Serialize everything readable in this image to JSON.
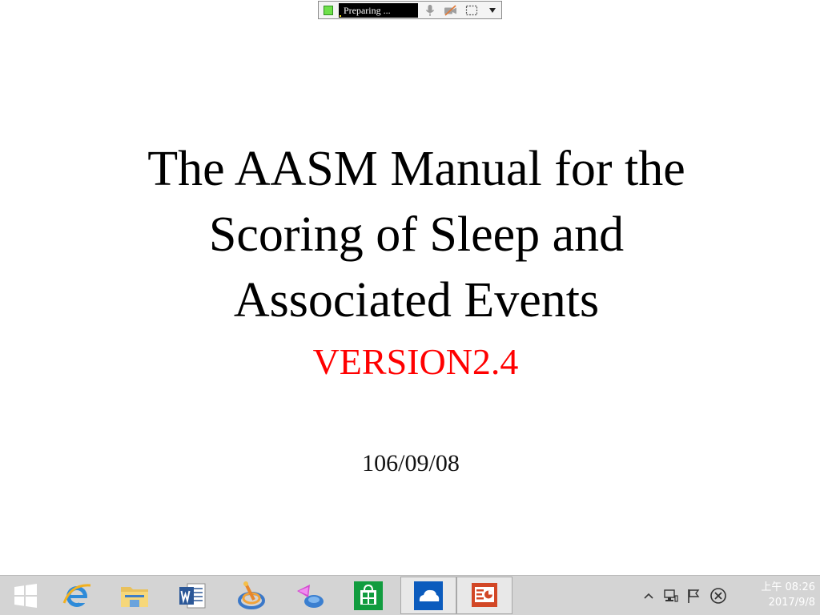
{
  "recorder": {
    "status_text": "Preparing ...",
    "status_progress": 0.02,
    "accent_color": "#6ee04a",
    "icons": [
      "microphone-icon",
      "camera-off-icon",
      "region-select-icon",
      "dropdown-arrow-icon"
    ]
  },
  "slide": {
    "title_lines": [
      "The AASM Manual for the",
      "Scoring of Sleep and",
      "Associated Events"
    ],
    "version": "VERSION2.4",
    "date": "106/09/08",
    "version_color": "#ff0000"
  },
  "taskbar": {
    "apps": [
      {
        "name": "start-button",
        "icon": "windows-logo-icon",
        "active": false
      },
      {
        "name": "internet-explorer",
        "icon": "internet-explorer-icon",
        "active": false
      },
      {
        "name": "file-explorer",
        "icon": "folder-icon",
        "active": false
      },
      {
        "name": "word",
        "icon": "word-icon",
        "active": false
      },
      {
        "name": "app-swirl",
        "icon": "swirl-app-icon",
        "active": false
      },
      {
        "name": "app-teardrop",
        "icon": "teardrop-app-icon",
        "active": false
      },
      {
        "name": "store",
        "icon": "store-icon",
        "active": false
      },
      {
        "name": "onedrive",
        "icon": "onedrive-icon",
        "active": true
      },
      {
        "name": "powerpoint",
        "icon": "powerpoint-icon",
        "active": true
      }
    ],
    "tray_icons": [
      "show-hidden-icons-arrow",
      "network-icon",
      "action-center-flag-icon",
      "recorder-close-icon"
    ],
    "clock": {
      "time": "上午 08:26",
      "date": "2017/9/8"
    }
  }
}
